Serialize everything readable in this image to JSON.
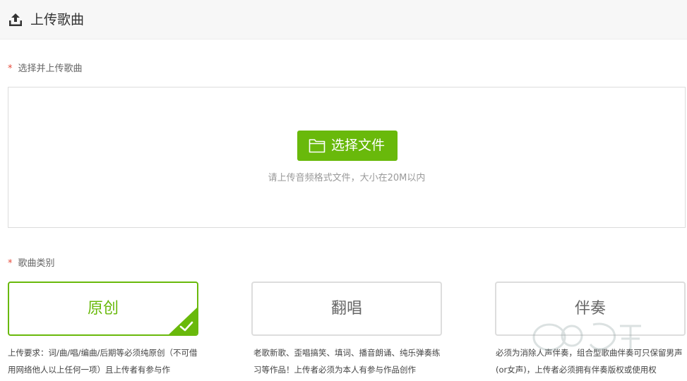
{
  "header": {
    "title": "上传歌曲",
    "icon": "upload-icon"
  },
  "upload_section": {
    "required_mark": "*",
    "label": "选择并上传歌曲",
    "button_label": "选择文件",
    "button_icon": "folder-icon",
    "hint": "请上传音频格式文件，大小在20M以内"
  },
  "category_section": {
    "required_mark": "*",
    "label": "歌曲类别",
    "options": [
      {
        "label": "原创",
        "selected": true,
        "description": "上传要求：词/曲/唱/编曲/后期等必须纯原创（不可借用网络他人以上任何一项）且上传者有参与作"
      },
      {
        "label": "翻唱",
        "selected": false,
        "description": "老歌新歌、歪唱搞笑、填词、播音朗诵、纯乐弹奏练习等作品！上传者必须为本人有参与作品创作"
      },
      {
        "label": "伴奏",
        "selected": false,
        "description": "必须为消除人声伴奏，组合型歌曲伴奏可只保留男声(or女声)，上传者必须拥有伴奏版权或使用权"
      }
    ]
  },
  "colors": {
    "accent_green": "#69b90b",
    "required_red": "#e64b3b"
  }
}
